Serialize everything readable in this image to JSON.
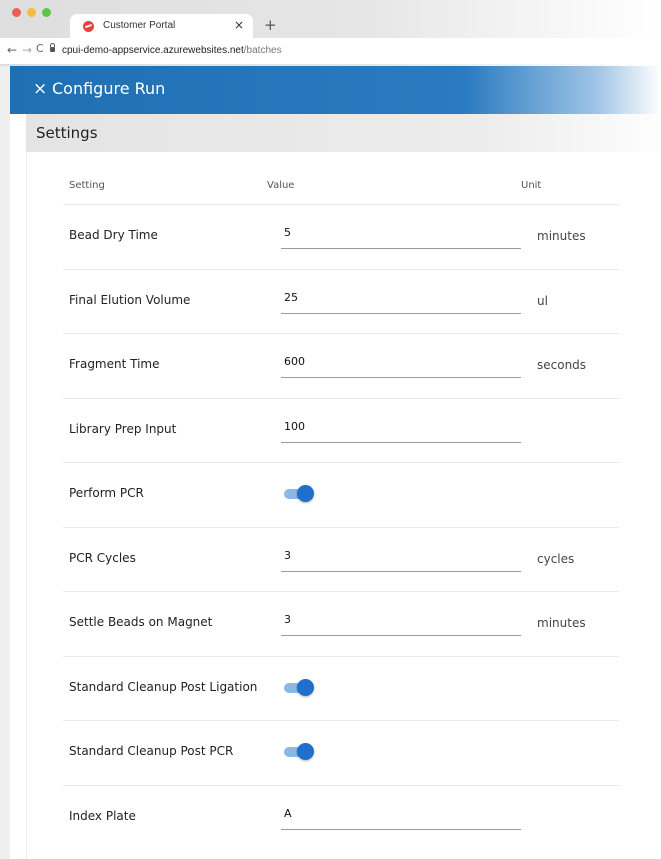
{
  "browser": {
    "tab_title": "Customer Portal",
    "tab_close": "×",
    "new_tab": "+",
    "url_host": "cpui-demo-appservice.azurewebsites.net",
    "url_path": "/batches"
  },
  "app": {
    "title": "Configure Run",
    "close_glyph": "×",
    "accent": "#1f6fb3"
  },
  "section": {
    "title": "Settings"
  },
  "table": {
    "columns": {
      "setting": "Setting",
      "value": "Value",
      "unit": "Unit"
    },
    "rows": [
      {
        "label": "Bead Dry Time",
        "type": "input",
        "value": "5",
        "unit": "minutes"
      },
      {
        "label": "Final Elution Volume",
        "type": "input",
        "value": "25",
        "unit": "ul"
      },
      {
        "label": "Fragment Time",
        "type": "input",
        "value": "600",
        "unit": "seconds"
      },
      {
        "label": "Library Prep Input",
        "type": "input",
        "value": "100",
        "unit": ""
      },
      {
        "label": "Perform PCR",
        "type": "toggle",
        "checked": true
      },
      {
        "label": "PCR Cycles",
        "type": "input",
        "value": "3",
        "unit": "cycles"
      },
      {
        "label": "Settle Beads on Magnet",
        "type": "input",
        "value": "3",
        "unit": "minutes"
      },
      {
        "label": "Standard Cleanup Post Ligation",
        "type": "toggle",
        "checked": true
      },
      {
        "label": "Standard Cleanup Post PCR",
        "type": "toggle",
        "checked": true
      },
      {
        "label": "Index Plate",
        "type": "input",
        "value": "A",
        "unit": ""
      }
    ]
  }
}
